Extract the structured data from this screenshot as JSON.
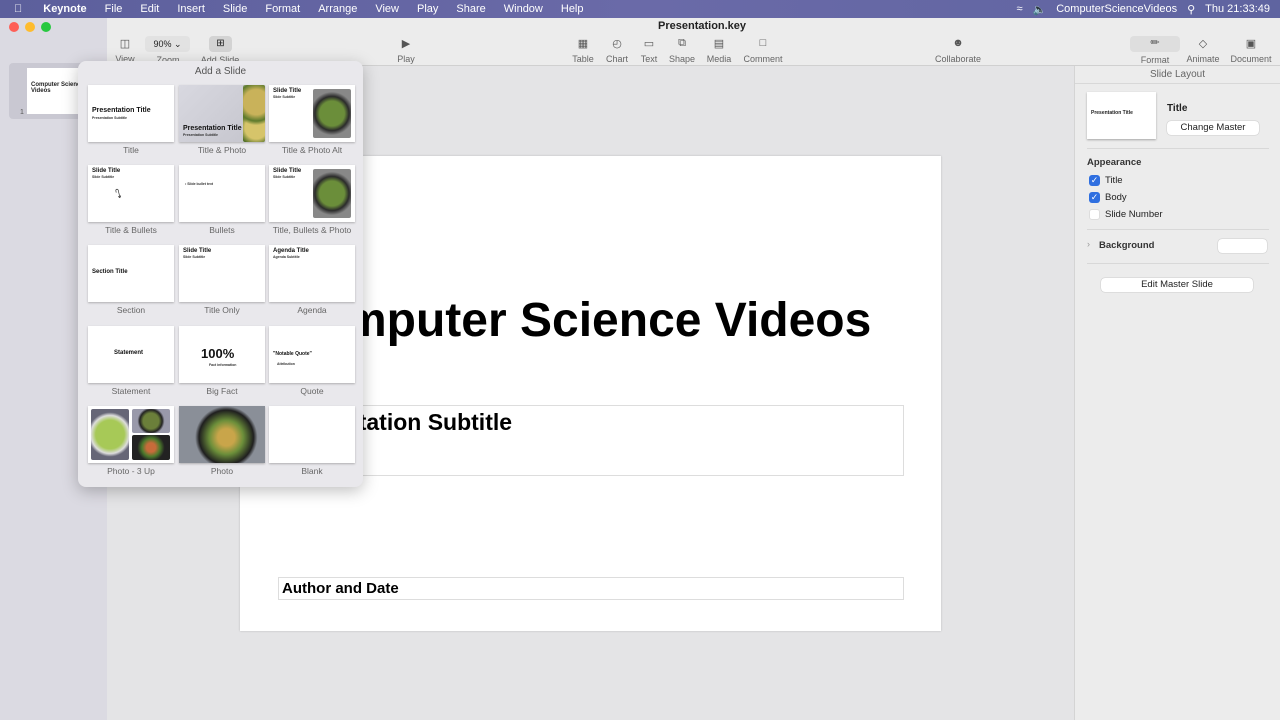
{
  "menubar": {
    "app": "Keynote",
    "items": [
      "File",
      "Edit",
      "Insert",
      "Slide",
      "Format",
      "Arrange",
      "View",
      "Play",
      "Share",
      "Window",
      "Help"
    ],
    "user": "ComputerScienceVideos",
    "clock": "Thu  21:33:49"
  },
  "window": {
    "title": "Presentation.key"
  },
  "toolbar": {
    "view": "View",
    "zoom": "Zoom",
    "zoom_value": "90%",
    "add_slide": "Add Slide",
    "play": "Play",
    "table": "Table",
    "chart": "Chart",
    "text": "Text",
    "shape": "Shape",
    "media": "Media",
    "comment": "Comment",
    "collaborate": "Collaborate",
    "format": "Format",
    "animate": "Animate",
    "document": "Document"
  },
  "navigator": {
    "slides": [
      {
        "number": "1",
        "title": "Computer Science Videos"
      }
    ]
  },
  "popover": {
    "title": "Add a Slide",
    "layouts": [
      {
        "label": "Title",
        "t1": "Presentation Title",
        "t2": "Presentation Subtitle"
      },
      {
        "label": "Title & Photo",
        "t1": "Presentation Title",
        "t2": "Presentation Subtitle"
      },
      {
        "label": "Title & Photo Alt",
        "t1": "Slide Title",
        "t2": "Slide Subtitle"
      },
      {
        "label": "Title & Bullets",
        "t1": "Slide Title",
        "t2": "Slide Subtitle"
      },
      {
        "label": "Bullets",
        "t1": "",
        "t2": "• Slide bullet text"
      },
      {
        "label": "Title, Bullets & Photo",
        "t1": "Slide Title",
        "t2": "Slide Subtitle"
      },
      {
        "label": "Section",
        "t1": "Section Title",
        "t2": ""
      },
      {
        "label": "Title Only",
        "t1": "Slide Title",
        "t2": "Slide Subtitle"
      },
      {
        "label": "Agenda",
        "t1": "Agenda Title",
        "t2": "Agenda Subtitle"
      },
      {
        "label": "Statement",
        "t1": "Statement",
        "t2": ""
      },
      {
        "label": "Big Fact",
        "t1": "100%",
        "t2": "Fact information"
      },
      {
        "label": "Quote",
        "t1": "\"Notable Quote\"",
        "t2": "Attribution"
      },
      {
        "label": "Photo - 3 Up",
        "t1": "",
        "t2": ""
      },
      {
        "label": "Photo",
        "t1": "",
        "t2": ""
      },
      {
        "label": "Blank",
        "t1": "",
        "t2": ""
      }
    ]
  },
  "slide": {
    "title": "Computer Science Videos",
    "subtitle": "Presentation Subtitle",
    "author": "Author and Date"
  },
  "inspector": {
    "header": "Slide Layout",
    "master_name": "Title",
    "master_thumb_title": "Presentation Title",
    "change_master": "Change Master",
    "appearance": "Appearance",
    "options": [
      {
        "label": "Title",
        "checked": true
      },
      {
        "label": "Body",
        "checked": true
      },
      {
        "label": "Slide Number",
        "checked": false
      }
    ],
    "background": "Background",
    "edit_master": "Edit Master Slide"
  },
  "colors": {
    "accent": "#2f6fe0",
    "menubar": "#5f64a0"
  }
}
